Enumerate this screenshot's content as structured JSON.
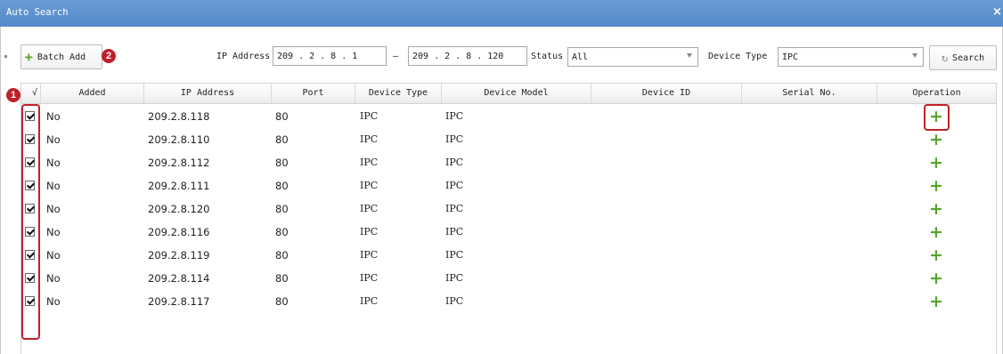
{
  "window": {
    "title": "Auto Search",
    "close_glyph": "×"
  },
  "toolbar": {
    "batch_add_label": "Batch Add",
    "badge_batch": "2",
    "ip_label": "IP Address",
    "ip_start": [
      "209",
      "2",
      "8",
      "1"
    ],
    "ip_sep": "–",
    "ip_end": [
      "209",
      "2",
      "8",
      "120"
    ],
    "status_label": "Status",
    "status_value": "All",
    "device_type_label": "Device Type",
    "device_type_value": "IPC",
    "search_label": "Search"
  },
  "table": {
    "badge_check": "1",
    "check_header": "√",
    "columns": [
      "Added",
      "IP Address",
      "Port",
      "Device Type",
      "Device Model",
      "Device ID",
      "Serial No.",
      "Operation"
    ],
    "rows": [
      {
        "added": "No",
        "ip": "209.2.8.118",
        "port": "80",
        "type": "IPC",
        "model": "IPC",
        "id": "",
        "serial": ""
      },
      {
        "added": "No",
        "ip": "209.2.8.110",
        "port": "80",
        "type": "IPC",
        "model": "IPC",
        "id": "",
        "serial": ""
      },
      {
        "added": "No",
        "ip": "209.2.8.112",
        "port": "80",
        "type": "IPC",
        "model": "IPC",
        "id": "",
        "serial": ""
      },
      {
        "added": "No",
        "ip": "209.2.8.111",
        "port": "80",
        "type": "IPC",
        "model": "IPC",
        "id": "",
        "serial": ""
      },
      {
        "added": "No",
        "ip": "209.2.8.120",
        "port": "80",
        "type": "IPC",
        "model": "IPC",
        "id": "",
        "serial": ""
      },
      {
        "added": "No",
        "ip": "209.2.8.116",
        "port": "80",
        "type": "IPC",
        "model": "IPC",
        "id": "",
        "serial": ""
      },
      {
        "added": "No",
        "ip": "209.2.8.119",
        "port": "80",
        "type": "IPC",
        "model": "IPC",
        "id": "",
        "serial": ""
      },
      {
        "added": "No",
        "ip": "209.2.8.114",
        "port": "80",
        "type": "IPC",
        "model": "IPC",
        "id": "",
        "serial": ""
      },
      {
        "added": "No",
        "ip": "209.2.8.117",
        "port": "80",
        "type": "IPC",
        "model": "IPC",
        "id": "",
        "serial": ""
      }
    ],
    "operation_glyph": "+"
  },
  "colors": {
    "titlebar": "#5e93d0",
    "accent_green": "#56a52a",
    "annotation_red": "#c0202a"
  },
  "icons": {
    "add": "plus-icon",
    "search": "refresh-icon",
    "dropdown": "chevron-down-icon"
  }
}
